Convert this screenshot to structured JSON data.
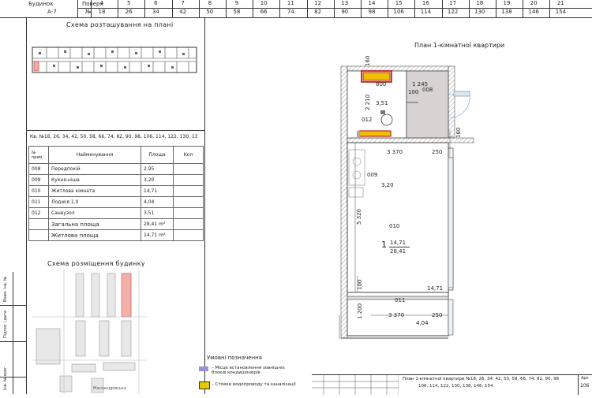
{
  "header": {
    "building_label": "Будинок",
    "building_value": "А-7",
    "floor_label": "Поверх",
    "number_label": "№",
    "floors": [
      "4",
      "5",
      "6",
      "7",
      "8",
      "9",
      "10",
      "11",
      "12",
      "13",
      "14",
      "15",
      "16",
      "17",
      "18",
      "19",
      "20",
      "21"
    ],
    "numbers": [
      "18",
      "26",
      "34",
      "42",
      "50",
      "58",
      "66",
      "74",
      "82",
      "90",
      "98",
      "106",
      "114",
      "122",
      "130",
      "138",
      "146",
      "154"
    ]
  },
  "left": {
    "floor_scheme_title": "Схема розташування на плані",
    "apartments_line": "Кв. №18, 26, 34, 42, 50, 58, 66, 74, 82, 90, 98, 106, 114, 122, 130, 13",
    "table_headers": {
      "num": "№ прим.",
      "name": "Найменування",
      "area": "Площа",
      "count": "Кол"
    },
    "rooms": [
      {
        "num": "008",
        "name": "Передпокій",
        "area": "2,95"
      },
      {
        "num": "009",
        "name": "Кухня-ніша",
        "area": "3,20"
      },
      {
        "num": "010",
        "name": "Житлова кімната",
        "area": "14,71"
      },
      {
        "num": "011",
        "name": "Лоджія 1,0",
        "area": "4,04"
      },
      {
        "num": "012",
        "name": "Санвузол",
        "area": "3,51"
      }
    ],
    "total_label": "Загальна площа",
    "total_value": "28,41 m²",
    "living_label": "Житлова площа",
    "living_value": "14,71 m²",
    "building_scheme_title": "Схема розміщення будинку",
    "street_label": "Массандрівська"
  },
  "stamp": {
    "sig_label": "Підпис і дата",
    "inv_label": "Інв. № ориг.",
    "replace_label": "Взам. інв. №",
    "inv_label2": "Інв. № дубл."
  },
  "plan": {
    "title": "План 1-кімнатної квартири",
    "dims": {
      "d160": "160",
      "d2210": "2 210",
      "d800": "800",
      "d1245": "1 245",
      "d100": "100",
      "d3370a": "3 370",
      "d250a": "250",
      "d5320": "5 320",
      "d3370b": "3 370",
      "d250b": "250",
      "d1200": "1 200",
      "d100b": "100",
      "d160b": "160"
    },
    "room_labels": {
      "r008": "008",
      "r012": "012",
      "a012": "3,51",
      "r009": "009",
      "a009": "3,20",
      "r010": "010",
      "apt_num": "1",
      "apt_living": "14,71",
      "apt_total": "28,41",
      "a010": "14,71",
      "r011": "011",
      "a011": "4,04"
    }
  },
  "legend": {
    "title": "Умовні позначення",
    "item1": "– Місце встановлення зовнішніх блоків кондиціонерів",
    "item2": "– Стояки водопроводу та каналізації",
    "swatch1_color": "#9b8fd8",
    "swatch2_color": "#e6c800"
  },
  "titleblock": {
    "text1": "План 1-кімнатної квартири №18, 26, 34, 42, 50, 58, 66, 74, 82, 90, 98",
    "text2": "106, 114, 122, 130, 138, 146, 154",
    "sheet_label": "Арк",
    "sheet_value": "106"
  }
}
